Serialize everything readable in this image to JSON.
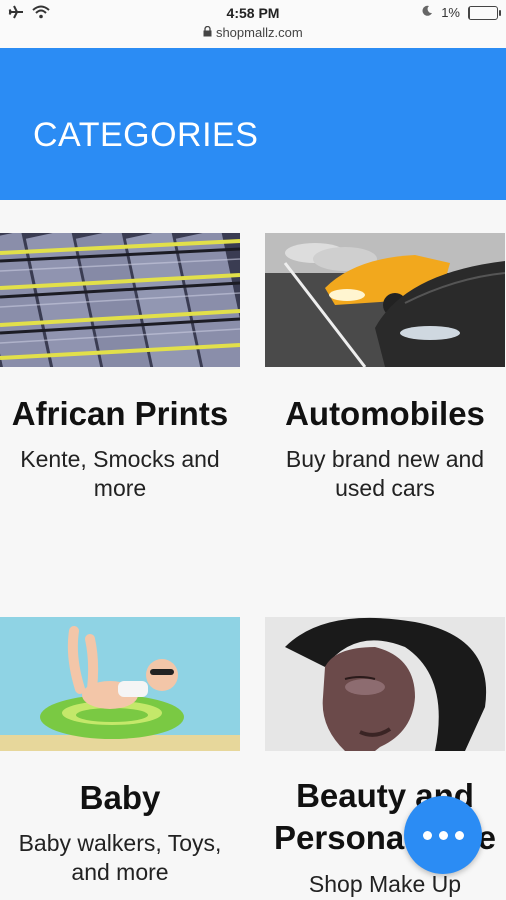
{
  "status_bar": {
    "time": "4:58 PM",
    "url": "shopmallz.com",
    "battery": "1%"
  },
  "header": {
    "title": "CATEGORIES"
  },
  "categories": [
    {
      "title": "African Prints",
      "description": "Kente, Smocks and more"
    },
    {
      "title": "Automobiles",
      "description": "Buy brand new and used cars"
    },
    {
      "title": "Baby",
      "description": "Baby walkers, Toys, and more"
    },
    {
      "title": "Beauty and Personal Care",
      "description": "Shop Make Up"
    }
  ],
  "colors": {
    "brand": "#2b8cf4"
  },
  "fab": {
    "icon": "more-horizontal-icon"
  }
}
